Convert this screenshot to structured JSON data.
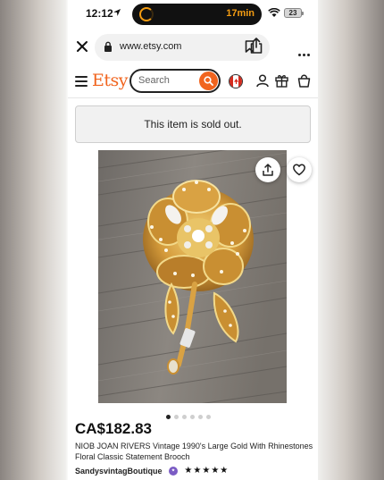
{
  "status_bar": {
    "time": "12:12",
    "timer": "17min",
    "battery": "23"
  },
  "browser": {
    "url": "www.etsy.com"
  },
  "header": {
    "logo": "Etsy",
    "search_placeholder": "Search"
  },
  "notice": {
    "sold_out": "This item is sold out."
  },
  "gallery": {
    "image_count": 6,
    "active_index": 0
  },
  "listing": {
    "price": "CA$182.83",
    "title": "NIOB JOAN RIVERS Vintage 1990's Large Gold With Rhinestones Floral Classic Statement Brooch",
    "shop_name": "SandysvintagBoutique",
    "stars": "★★★★★",
    "rating": 5
  },
  "colors": {
    "brand": "#f1641e",
    "star_seller_badge": "#7b5cc4",
    "timer": "#f39c12"
  },
  "icons": [
    "location-arrow-icon",
    "timer-icon",
    "wifi-icon",
    "battery-icon",
    "close-icon",
    "lock-icon",
    "bookmark-icon",
    "share-icon",
    "more-icon",
    "menu-icon",
    "search-icon",
    "canada-flag-icon",
    "user-icon",
    "gift-icon",
    "cart-icon",
    "heart-icon",
    "star-seller-icon"
  ]
}
